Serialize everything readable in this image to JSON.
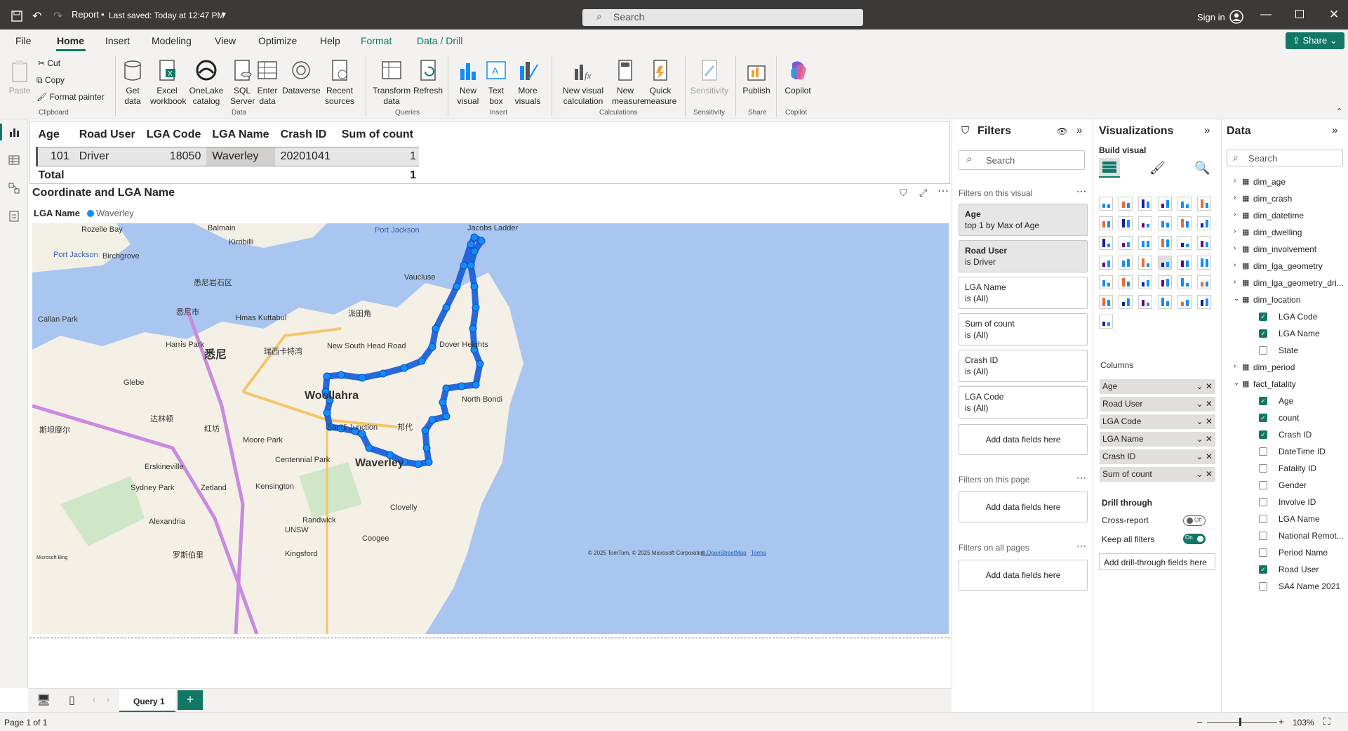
{
  "titlebar": {
    "doc_title": "Report",
    "saved": "Last saved: Today at 12:47 PM",
    "search_placeholder": "Search",
    "sign_in": "Sign in"
  },
  "menu": {
    "file": "File",
    "home": "Home",
    "insert": "Insert",
    "modeling": "Modeling",
    "view": "View",
    "optimize": "Optimize",
    "help": "Help",
    "format": "Format",
    "data_drill": "Data / Drill",
    "share": "Share"
  },
  "ribbon": {
    "paste": "Paste",
    "cut": "Cut",
    "copy": "Copy",
    "format_painter": "Format painter",
    "clipboard": "Clipboard",
    "get_data": "Get data",
    "excel": "Excel workbook",
    "onelake": "OneLake catalog",
    "sql": "SQL Server",
    "enter_data": "Enter data",
    "dataverse": "Dataverse",
    "recent": "Recent sources",
    "data_group": "Data",
    "transform": "Transform data",
    "refresh": "Refresh",
    "queries": "Queries",
    "new_visual": "New visual",
    "text_box": "Text box",
    "more_visuals": "More visuals",
    "insert_group": "Insert",
    "new_visual_calc": "New visual calculation",
    "new_measure": "New measure",
    "quick_measure": "Quick measure",
    "calculations": "Calculations",
    "sensitivity": "Sensitivity",
    "sensitivity_group": "Sensitivity",
    "publish": "Publish",
    "share_group": "Share",
    "copilot": "Copilot",
    "copilot_group": "Copilot"
  },
  "table": {
    "headers": [
      "Age",
      "Road User",
      "LGA Code",
      "LGA Name",
      "Crash ID",
      "Sum of count"
    ],
    "row": [
      "101",
      "Driver",
      "18050",
      "Waverley",
      "20201041",
      "1"
    ],
    "total_label": "Total",
    "total_value": "1"
  },
  "map": {
    "title": "Coordinate and LGA Name",
    "legend_label": "LGA Name",
    "legend_item": "Waverley",
    "legend_color": "#118dff",
    "attribution": "© 2025 TomTom, © 2025 Microsoft Corporation,",
    "osm": "© OpenStreetMap",
    "terms": "Terms",
    "bing": "Microsoft Bing",
    "labels": [
      "Port Jackson",
      "Jacobs Ladder",
      "Kirribilli",
      "Birchgrove",
      "Port Jackson",
      "Vaucluse",
      "悉尼岩石区",
      "派田角",
      "悉尼市",
      "Hmas Kuttabul",
      "Callan Park",
      "Harris Park",
      "悉尼",
      "瑞西卡特湾",
      "New South Head Road",
      "Dover Heights",
      "Glebe",
      "Woollahra",
      "North Bondi",
      "斯坦摩尔",
      "达林顿",
      "红坊",
      "Bondi Junction",
      "邦代",
      "Moore Park",
      "Centennial Park",
      "Waverley",
      "Erskineville",
      "Zetland",
      "Kensington",
      "Sydney Park",
      "Alexandria",
      "Randwick",
      "UNSW",
      "Clovelly",
      "Coogee",
      "Kingsford",
      "罗斯伯里",
      "Rozelle Bay",
      "Balmain"
    ]
  },
  "filters": {
    "title": "Filters",
    "search": "Search",
    "on_visual": "Filters on this visual",
    "on_page": "Filters on this page",
    "on_all": "Filters on all pages",
    "add": "Add data fields here",
    "cards": [
      {
        "name": "Age",
        "value": "top 1 by Max of Age"
      },
      {
        "name": "Road User",
        "value": "is Driver"
      },
      {
        "name": "LGA Name",
        "value": "is (All)"
      },
      {
        "name": "Sum of count",
        "value": "is (All)"
      },
      {
        "name": "Crash ID",
        "value": "is (All)"
      },
      {
        "name": "LGA Code",
        "value": "is (All)"
      }
    ]
  },
  "viz": {
    "title": "Visualizations",
    "build": "Build visual",
    "columns": "Columns",
    "wells": [
      "Age",
      "Road User",
      "LGA Code",
      "LGA Name",
      "Crash ID",
      "Sum of count"
    ],
    "drill": "Drill through",
    "cross_report": "Cross-report",
    "cross_state": "Off",
    "keep_filters": "Keep all filters",
    "keep_state": "On",
    "add_drill": "Add drill-through fields here"
  },
  "data": {
    "title": "Data",
    "search": "Search",
    "tables": [
      "dim_age",
      "dim_crash",
      "dim_datetime",
      "dim_dwelling",
      "dim_involvement",
      "dim_lga_geometry",
      "dim_lga_geometry_dri...",
      "dim_location"
    ],
    "location_fields": [
      {
        "name": "LGA Code",
        "checked": true
      },
      {
        "name": "LGA Name",
        "checked": true
      },
      {
        "name": "State",
        "checked": false
      }
    ],
    "period": "dim_period",
    "fact": "fact_fatality",
    "fact_fields": [
      {
        "name": "Age",
        "checked": true
      },
      {
        "name": "count",
        "checked": true
      },
      {
        "name": "Crash ID",
        "checked": true
      },
      {
        "name": "DateTime ID",
        "checked": false
      },
      {
        "name": "Fatality ID",
        "checked": false
      },
      {
        "name": "Gender",
        "checked": false
      },
      {
        "name": "Involve ID",
        "checked": false
      },
      {
        "name": "LGA Name",
        "checked": false
      },
      {
        "name": "National Remot...",
        "checked": false
      },
      {
        "name": "Period Name",
        "checked": false
      },
      {
        "name": "Road User",
        "checked": true
      },
      {
        "name": "SA4 Name 2021",
        "checked": false
      }
    ]
  },
  "footer": {
    "page_tab": "Query 1",
    "page_info": "Page 1 of 1",
    "zoom": "103%"
  }
}
